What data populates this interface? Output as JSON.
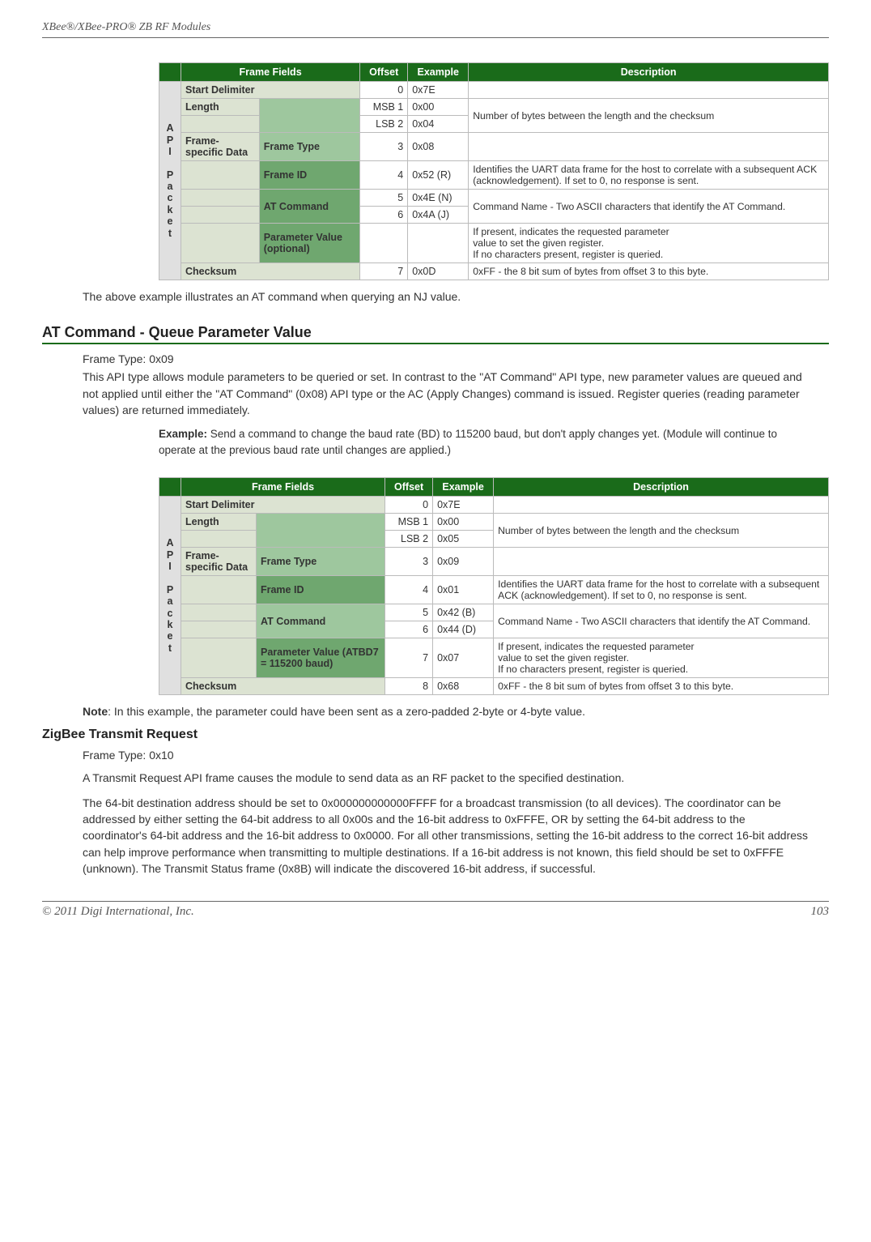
{
  "header": {
    "running": "XBee®/XBee-PRO® ZB RF Modules"
  },
  "footer": {
    "left": "© 2011 Digi International, Inc.",
    "right": "103"
  },
  "tbl_hdr": {
    "frame_fields": "Frame Fields",
    "offset": "Offset",
    "example": "Example",
    "description": "Description"
  },
  "api_label": "API Packet",
  "rows_a": {
    "start": {
      "label": "Start Delimiter",
      "offset": "0",
      "example": "0x7E"
    },
    "length_label": "Length",
    "len_msb": {
      "offset": "MSB 1",
      "example": "0x00"
    },
    "len_lsb": {
      "offset": "LSB 2",
      "example": "0x04"
    },
    "len_desc": "Number of bytes between the length and the checksum",
    "fsd_label": "Frame-specific Data",
    "frame_type": {
      "label": "Frame Type",
      "offset": "3",
      "example": "0x08"
    },
    "frame_id": {
      "label": "Frame ID",
      "offset": "4",
      "example": "0x52 (R)",
      "desc": "Identifies the UART data frame for the host to correlate with a subsequent ACK (acknowledgement). If set to 0, no response is sent."
    },
    "atcmd_label": "AT Command",
    "atcmd1": {
      "offset": "5",
      "example": "0x4E (N)"
    },
    "atcmd2": {
      "offset": "6",
      "example": "0x4A (J)"
    },
    "atcmd_desc": "Command Name - Two ASCII characters that identify the AT Command.",
    "param": {
      "label": "Parameter Value (optional)",
      "desc1": "If present, indicates the requested parameter",
      "desc2": "value to set the given register.",
      "desc3": "If no characters present, register is queried."
    },
    "checksum": {
      "label": "Checksum",
      "offset": " 7",
      "example": " 0x0D",
      "desc": "0xFF - the 8 bit sum of bytes from offset 3 to this byte."
    }
  },
  "caption_a": "The above example illustrates an AT command when querying an NJ value.",
  "section_queue": {
    "title": "AT Command - Queue Parameter Value",
    "frame_type_line": "Frame Type: 0x09",
    "para": "This API type allows module parameters to be queried or set. In contrast to the \"AT Command\" API type, new parameter values are queued and not applied until either the \"AT Command\" (0x08) API type or the AC (Apply Changes) command is issued. Register queries (reading parameter values) are returned immediately.",
    "example_label": "Example:",
    "example_text": " Send a command to change the baud rate (BD) to 115200 baud, but don't apply changes yet. (Module will continue to operate at the previous baud rate until changes are applied.)"
  },
  "rows_b": {
    "start": {
      "label": "Start Delimiter",
      "offset": "0",
      "example": "0x7E"
    },
    "length_label": "Length",
    "len_msb": {
      "offset": "MSB 1",
      "example": "0x00"
    },
    "len_lsb": {
      "offset": "LSB 2",
      "example": "0x05"
    },
    "len_desc": "Number of bytes between the length and the checksum",
    "fsd_label": "Frame-specific Data",
    "frame_type": {
      "label": "Frame Type",
      "offset": "3",
      "example": "0x09"
    },
    "frame_id": {
      "label": "Frame ID",
      "offset": "4",
      "example": "0x01",
      "desc": "Identifies the UART data frame for the host to correlate with a subsequent ACK (acknowledgement). If set to 0, no response is sent."
    },
    "atcmd_label": "AT Command",
    "atcmd1": {
      "offset": "5",
      "example": "0x42 (B)"
    },
    "atcmd2": {
      "offset": "6",
      "example": "0x44 (D)"
    },
    "atcmd_desc": "Command Name - Two ASCII characters that identify the AT Command.",
    "param": {
      "label": "Parameter Value (ATBD7 = 115200 baud)",
      "offset": "7",
      "example": "0x07",
      "desc1": "If present, indicates the requested parameter",
      "desc2": "value to set the given register.",
      "desc3": "If no characters present, register is queried."
    },
    "checksum": {
      "label": "Checksum",
      "offset": "8",
      "example": "0x68",
      "desc": "0xFF - the 8 bit sum of bytes from offset 3 to this byte."
    }
  },
  "note_b": {
    "label": "Note",
    "text": ": In this example, the parameter could have been sent as a zero-padded 2-byte or 4-byte value."
  },
  "section_transmit": {
    "title": "ZigBee Transmit Request",
    "frame_type_line": "Frame Type: 0x10",
    "p1": "A Transmit Request API frame causes the module to send data as an RF packet to the specified destination.",
    "p2": "The 64-bit destination address should be set to 0x000000000000FFFF for a broadcast transmission (to all devices). The coordinator can be addressed by either setting the 64-bit address to all 0x00s and the 16-bit address to 0xFFFE, OR by setting the 64-bit address to the coordinator's 64-bit address and the 16-bit address to 0x0000. For all other transmissions, setting the 16-bit address to the correct 16-bit address can help improve performance when transmitting to multiple destinations. If a 16-bit address is not known, this field should be set to 0xFFFE (unknown). The Transmit Status frame (0x8B) will indicate the discovered 16-bit address, if successful."
  }
}
